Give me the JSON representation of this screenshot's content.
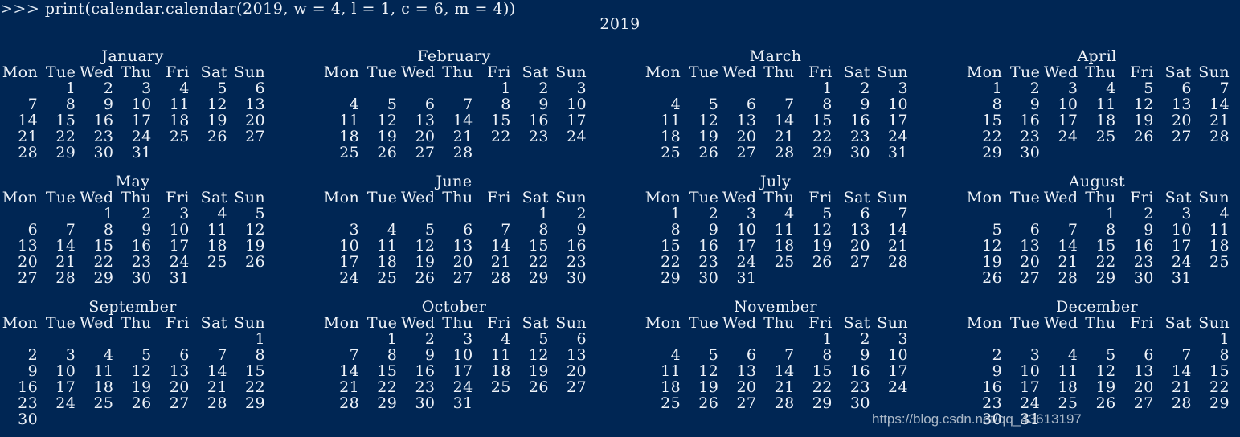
{
  "terminal": {
    "prompt_sigil": ">>> ",
    "command": "print(calendar.calendar(2019, w = 4, l = 1, c = 6, m = 4))",
    "background_color": "#002654",
    "text_color": "#eef2f8"
  },
  "calendar": {
    "year": "2019",
    "weekday_headers": [
      "Mon",
      "Tue",
      "Wed",
      "Thu",
      "Fri",
      "Sat",
      "Sun"
    ],
    "months_per_row": 4,
    "rows": [
      {
        "months": [
          {
            "name": "January",
            "weeks": [
              [
                "",
                "1",
                "2",
                "3",
                "4",
                "5",
                "6"
              ],
              [
                "7",
                "8",
                "9",
                "10",
                "11",
                "12",
                "13"
              ],
              [
                "14",
                "15",
                "16",
                "17",
                "18",
                "19",
                "20"
              ],
              [
                "21",
                "22",
                "23",
                "24",
                "25",
                "26",
                "27"
              ],
              [
                "28",
                "29",
                "30",
                "31",
                "",
                "",
                ""
              ]
            ]
          },
          {
            "name": "February",
            "weeks": [
              [
                "",
                "",
                "",
                "",
                "1",
                "2",
                "3"
              ],
              [
                "4",
                "5",
                "6",
                "7",
                "8",
                "9",
                "10"
              ],
              [
                "11",
                "12",
                "13",
                "14",
                "15",
                "16",
                "17"
              ],
              [
                "18",
                "19",
                "20",
                "21",
                "22",
                "23",
                "24"
              ],
              [
                "25",
                "26",
                "27",
                "28",
                "",
                "",
                ""
              ]
            ]
          },
          {
            "name": "March",
            "weeks": [
              [
                "",
                "",
                "",
                "",
                "1",
                "2",
                "3"
              ],
              [
                "4",
                "5",
                "6",
                "7",
                "8",
                "9",
                "10"
              ],
              [
                "11",
                "12",
                "13",
                "14",
                "15",
                "16",
                "17"
              ],
              [
                "18",
                "19",
                "20",
                "21",
                "22",
                "23",
                "24"
              ],
              [
                "25",
                "26",
                "27",
                "28",
                "29",
                "30",
                "31"
              ]
            ]
          },
          {
            "name": "April",
            "weeks": [
              [
                "1",
                "2",
                "3",
                "4",
                "5",
                "6",
                "7"
              ],
              [
                "8",
                "9",
                "10",
                "11",
                "12",
                "13",
                "14"
              ],
              [
                "15",
                "16",
                "17",
                "18",
                "19",
                "20",
                "21"
              ],
              [
                "22",
                "23",
                "24",
                "25",
                "26",
                "27",
                "28"
              ],
              [
                "29",
                "30",
                "",
                "",
                "",
                "",
                ""
              ]
            ]
          }
        ]
      },
      {
        "months": [
          {
            "name": "May",
            "weeks": [
              [
                "",
                "",
                "1",
                "2",
                "3",
                "4",
                "5"
              ],
              [
                "6",
                "7",
                "8",
                "9",
                "10",
                "11",
                "12"
              ],
              [
                "13",
                "14",
                "15",
                "16",
                "17",
                "18",
                "19"
              ],
              [
                "20",
                "21",
                "22",
                "23",
                "24",
                "25",
                "26"
              ],
              [
                "27",
                "28",
                "29",
                "30",
                "31",
                "",
                ""
              ]
            ]
          },
          {
            "name": "June",
            "weeks": [
              [
                "",
                "",
                "",
                "",
                "",
                "1",
                "2"
              ],
              [
                "3",
                "4",
                "5",
                "6",
                "7",
                "8",
                "9"
              ],
              [
                "10",
                "11",
                "12",
                "13",
                "14",
                "15",
                "16"
              ],
              [
                "17",
                "18",
                "19",
                "20",
                "21",
                "22",
                "23"
              ],
              [
                "24",
                "25",
                "26",
                "27",
                "28",
                "29",
                "30"
              ]
            ]
          },
          {
            "name": "July",
            "weeks": [
              [
                "1",
                "2",
                "3",
                "4",
                "5",
                "6",
                "7"
              ],
              [
                "8",
                "9",
                "10",
                "11",
                "12",
                "13",
                "14"
              ],
              [
                "15",
                "16",
                "17",
                "18",
                "19",
                "20",
                "21"
              ],
              [
                "22",
                "23",
                "24",
                "25",
                "26",
                "27",
                "28"
              ],
              [
                "29",
                "30",
                "31",
                "",
                "",
                "",
                ""
              ]
            ]
          },
          {
            "name": "August",
            "weeks": [
              [
                "",
                "",
                "",
                "1",
                "2",
                "3",
                "4"
              ],
              [
                "5",
                "6",
                "7",
                "8",
                "9",
                "10",
                "11"
              ],
              [
                "12",
                "13",
                "14",
                "15",
                "16",
                "17",
                "18"
              ],
              [
                "19",
                "20",
                "21",
                "22",
                "23",
                "24",
                "25"
              ],
              [
                "26",
                "27",
                "28",
                "29",
                "30",
                "31",
                ""
              ]
            ]
          }
        ]
      },
      {
        "months": [
          {
            "name": "September",
            "weeks": [
              [
                "",
                "",
                "",
                "",
                "",
                "",
                "1"
              ],
              [
                "2",
                "3",
                "4",
                "5",
                "6",
                "7",
                "8"
              ],
              [
                "9",
                "10",
                "11",
                "12",
                "13",
                "14",
                "15"
              ],
              [
                "16",
                "17",
                "18",
                "19",
                "20",
                "21",
                "22"
              ],
              [
                "23",
                "24",
                "25",
                "26",
                "27",
                "28",
                "29"
              ],
              [
                "30",
                "",
                "",
                "",
                "",
                "",
                ""
              ]
            ]
          },
          {
            "name": "October",
            "weeks": [
              [
                "",
                "1",
                "2",
                "3",
                "4",
                "5",
                "6"
              ],
              [
                "7",
                "8",
                "9",
                "10",
                "11",
                "12",
                "13"
              ],
              [
                "14",
                "15",
                "16",
                "17",
                "18",
                "19",
                "20"
              ],
              [
                "21",
                "22",
                "23",
                "24",
                "25",
                "26",
                "27"
              ],
              [
                "28",
                "29",
                "30",
                "31",
                "",
                "",
                ""
              ],
              [
                "",
                "",
                "",
                "",
                "",
                "",
                ""
              ]
            ]
          },
          {
            "name": "November",
            "weeks": [
              [
                "",
                "",
                "",
                "",
                "1",
                "2",
                "3"
              ],
              [
                "4",
                "5",
                "6",
                "7",
                "8",
                "9",
                "10"
              ],
              [
                "11",
                "12",
                "13",
                "14",
                "15",
                "16",
                "17"
              ],
              [
                "18",
                "19",
                "20",
                "21",
                "22",
                "23",
                "24"
              ],
              [
                "25",
                "26",
                "27",
                "28",
                "29",
                "30",
                ""
              ],
              [
                "",
                "",
                "",
                "",
                "",
                "",
                ""
              ]
            ]
          },
          {
            "name": "December",
            "weeks": [
              [
                "",
                "",
                "",
                "",
                "",
                "",
                "1"
              ],
              [
                "2",
                "3",
                "4",
                "5",
                "6",
                "7",
                "8"
              ],
              [
                "9",
                "10",
                "11",
                "12",
                "13",
                "14",
                "15"
              ],
              [
                "16",
                "17",
                "18",
                "19",
                "20",
                "21",
                "22"
              ],
              [
                "23",
                "24",
                "25",
                "26",
                "27",
                "28",
                "29"
              ],
              [
                "30",
                "31",
                "",
                "",
                "",
                "",
                ""
              ]
            ]
          }
        ]
      }
    ]
  },
  "watermark": {
    "text": "https://blog.csdn.net/qq_43613197"
  }
}
